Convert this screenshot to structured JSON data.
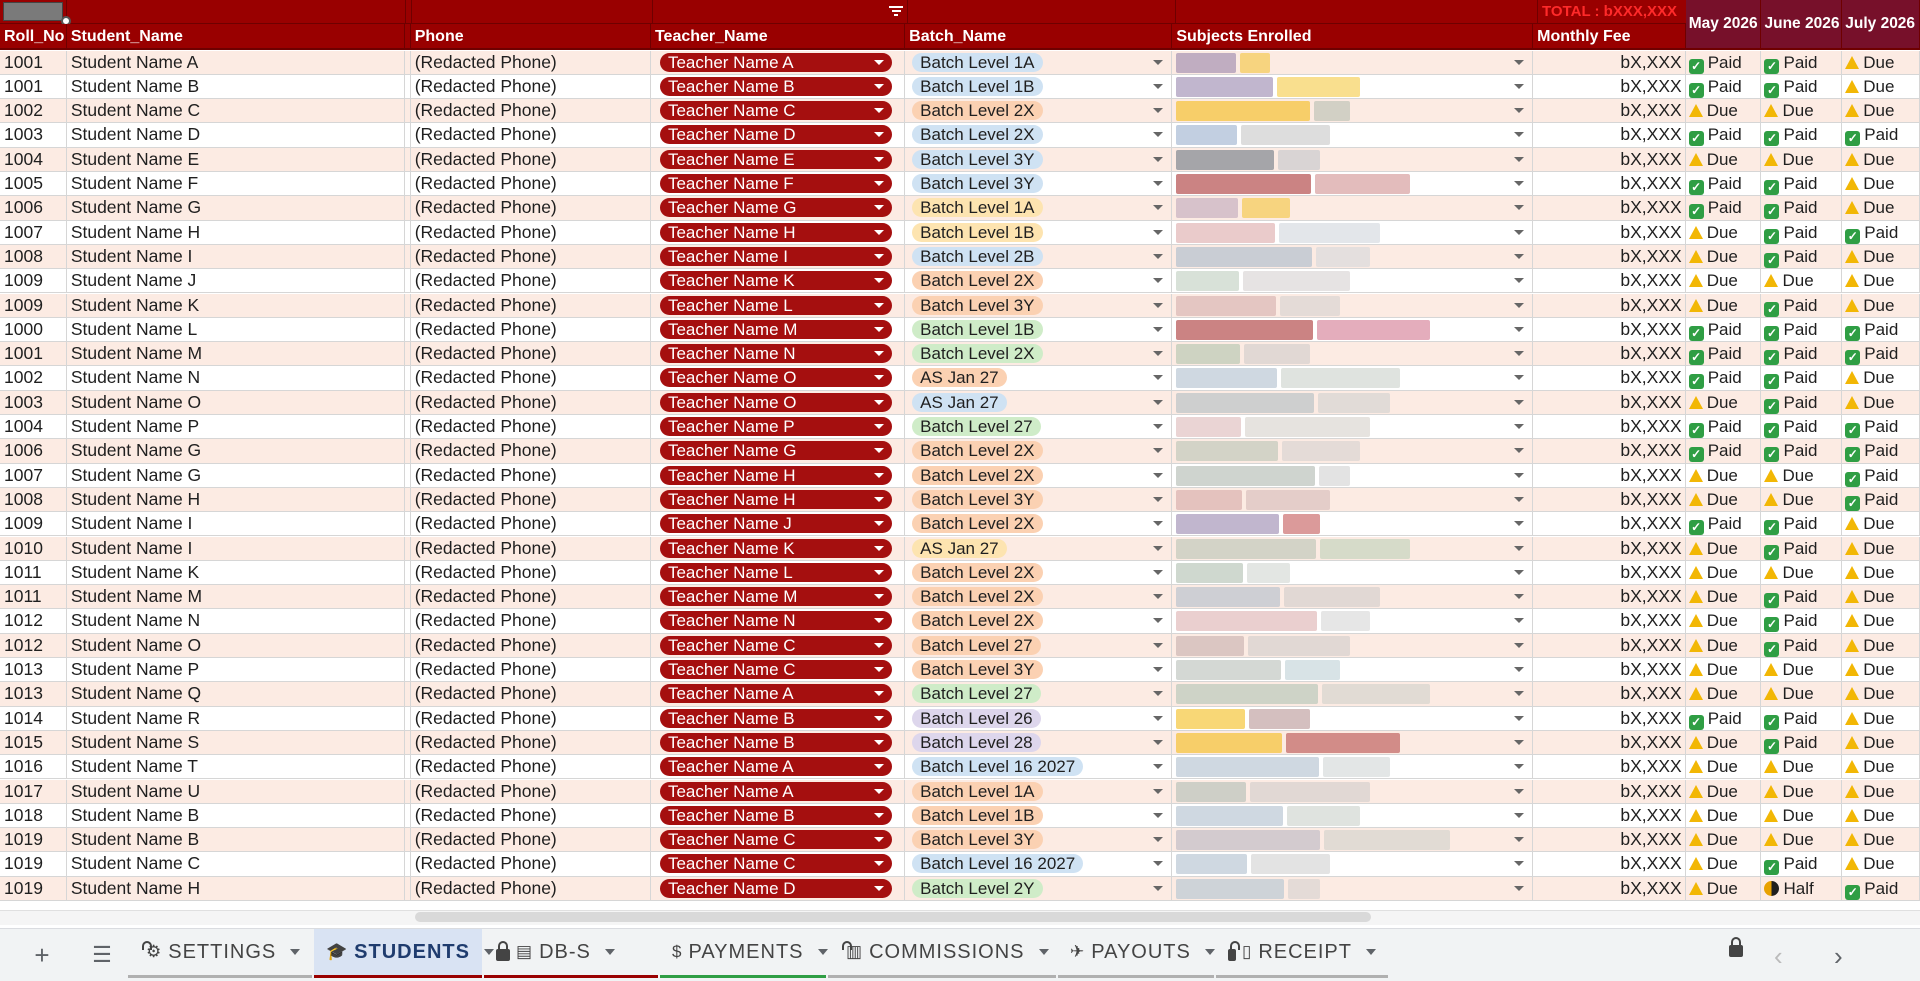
{
  "header": {
    "total_label": "TOTAL : bXXX,XXX",
    "columns": {
      "roll": "Roll_No",
      "name": "Student_Name",
      "phone": "Phone",
      "teacher": "Teacher_Name",
      "batch": "Batch_Name",
      "subjects": "Subjects Enrolled",
      "fee": "Monthly Fee",
      "m1": "May 2026",
      "m2": "June 2026",
      "m3": "July 2026"
    }
  },
  "colors": {
    "header_bg": "#990000",
    "month_header_bg": "#77102a",
    "teacher_chip": "#a50f0f",
    "band": "#fcebe3",
    "paid": "#2f9e44",
    "due": "#f2b705"
  },
  "rows": [
    {
      "roll": "1001",
      "name": "Student Name A",
      "phone": "(Redacted Phone)",
      "teacher": "Teacher Name A",
      "batch": "Batch Level 1A",
      "batch_color": "blue",
      "fee": "bX,XXX",
      "m1": "Paid",
      "m2": "Paid",
      "m3": "Due"
    },
    {
      "roll": "1001",
      "name": "Student Name B",
      "phone": "(Redacted Phone)",
      "teacher": "Teacher Name B",
      "batch": "Batch Level 1B",
      "batch_color": "blue",
      "fee": "bX,XXX",
      "m1": "Paid",
      "m2": "Paid",
      "m3": "Due"
    },
    {
      "roll": "1002",
      "name": "Student Name C",
      "phone": "(Redacted Phone)",
      "teacher": "Teacher Name C",
      "batch": "Batch Level 2X",
      "batch_color": "orange",
      "fee": "bX,XXX",
      "m1": "Due",
      "m2": "Due",
      "m3": "Due"
    },
    {
      "roll": "1003",
      "name": "Student Name D",
      "phone": "(Redacted Phone)",
      "teacher": "Teacher Name D",
      "batch": "Batch Level 2X",
      "batch_color": "blue",
      "fee": "bX,XXX",
      "m1": "Paid",
      "m2": "Paid",
      "m3": "Paid"
    },
    {
      "roll": "1004",
      "name": "Student Name E",
      "phone": "(Redacted Phone)",
      "teacher": "Teacher Name E",
      "batch": "Batch Level 3Y",
      "batch_color": "blue",
      "fee": "bX,XXX",
      "m1": "Due",
      "m2": "Due",
      "m3": "Due"
    },
    {
      "roll": "1005",
      "name": "Student Name F",
      "phone": "(Redacted Phone)",
      "teacher": "Teacher Name F",
      "batch": "Batch Level 3Y",
      "batch_color": "blue",
      "fee": "bX,XXX",
      "m1": "Paid",
      "m2": "Paid",
      "m3": "Due"
    },
    {
      "roll": "1006",
      "name": "Student Name G",
      "phone": "(Redacted Phone)",
      "teacher": "Teacher Name G",
      "batch": "Batch Level 1A",
      "batch_color": "yellow",
      "fee": "bX,XXX",
      "m1": "Paid",
      "m2": "Paid",
      "m3": "Due"
    },
    {
      "roll": "1007",
      "name": "Student Name H",
      "phone": "(Redacted Phone)",
      "teacher": "Teacher Name H",
      "batch": "Batch Level 1B",
      "batch_color": "yellow",
      "fee": "bX,XXX",
      "m1": "Due",
      "m2": "Paid",
      "m3": "Paid"
    },
    {
      "roll": "1008",
      "name": "Student Name I",
      "phone": "(Redacted Phone)",
      "teacher": "Teacher Name I",
      "batch": "Batch Level 2B",
      "batch_color": "blue",
      "fee": "bX,XXX",
      "m1": "Due",
      "m2": "Paid",
      "m3": "Due"
    },
    {
      "roll": "1009",
      "name": "Student Name J",
      "phone": "(Redacted Phone)",
      "teacher": "Teacher Name K",
      "batch": "Batch Level 2X",
      "batch_color": "orange",
      "fee": "bX,XXX",
      "m1": "Due",
      "m2": "Due",
      "m3": "Due"
    },
    {
      "roll": "1009",
      "name": "Student Name K",
      "phone": "(Redacted Phone)",
      "teacher": "Teacher Name L",
      "batch": "Batch Level 3Y",
      "batch_color": "orange",
      "fee": "bX,XXX",
      "m1": "Due",
      "m2": "Paid",
      "m3": "Due"
    },
    {
      "roll": "1000",
      "name": "Student Name L",
      "phone": "(Redacted Phone)",
      "teacher": "Teacher Name M",
      "batch": "Batch Level 1B",
      "batch_color": "green",
      "fee": "bX,XXX",
      "m1": "Paid",
      "m2": "Paid",
      "m3": "Paid"
    },
    {
      "roll": "1001",
      "name": "Student Name M",
      "phone": "(Redacted Phone)",
      "teacher": "Teacher Name N",
      "batch": "Batch Level 2X",
      "batch_color": "green",
      "fee": "bX,XXX",
      "m1": "Paid",
      "m2": "Paid",
      "m3": "Paid"
    },
    {
      "roll": "1002",
      "name": "Student Name N",
      "phone": "(Redacted Phone)",
      "teacher": "Teacher Name O",
      "batch": "AS Jan 27",
      "batch_color": "orange",
      "fee": "bX,XXX",
      "m1": "Paid",
      "m2": "Paid",
      "m3": "Due"
    },
    {
      "roll": "1003",
      "name": "Student Name O",
      "phone": "(Redacted Phone)",
      "teacher": "Teacher Name O",
      "batch": "AS Jan 27",
      "batch_color": "blue",
      "fee": "bX,XXX",
      "m1": "Due",
      "m2": "Paid",
      "m3": "Due"
    },
    {
      "roll": "1004",
      "name": "Student Name P",
      "phone": "(Redacted Phone)",
      "teacher": "Teacher Name P",
      "batch": "Batch Level 27",
      "batch_color": "green",
      "fee": "bX,XXX",
      "m1": "Paid",
      "m2": "Paid",
      "m3": "Paid"
    },
    {
      "roll": "1006",
      "name": "Student Name G",
      "phone": "(Redacted Phone)",
      "teacher": "Teacher Name G",
      "batch": "Batch Level 2X",
      "batch_color": "orange",
      "fee": "bX,XXX",
      "m1": "Paid",
      "m2": "Paid",
      "m3": "Paid"
    },
    {
      "roll": "1007",
      "name": "Student Name G",
      "phone": "(Redacted Phone)",
      "teacher": "Teacher Name H",
      "batch": "Batch Level 2X",
      "batch_color": "orange",
      "fee": "bX,XXX",
      "m1": "Due",
      "m2": "Due",
      "m3": "Paid"
    },
    {
      "roll": "1008",
      "name": "Student Name H",
      "phone": "(Redacted Phone)",
      "teacher": "Teacher Name H",
      "batch": "Batch Level 3Y",
      "batch_color": "orange",
      "fee": "bX,XXX",
      "m1": "Due",
      "m2": "Due",
      "m3": "Paid"
    },
    {
      "roll": "1009",
      "name": "Student Name I",
      "phone": "(Redacted Phone)",
      "teacher": "Teacher Name J",
      "batch": "Batch Level 2X",
      "batch_color": "orange",
      "fee": "bX,XXX",
      "m1": "Paid",
      "m2": "Paid",
      "m3": "Due"
    },
    {
      "roll": "1010",
      "name": "Student Name I",
      "phone": "(Redacted Phone)",
      "teacher": "Teacher Name K",
      "batch": "AS Jan 27",
      "batch_color": "yellow",
      "fee": "bX,XXX",
      "m1": "Due",
      "m2": "Paid",
      "m3": "Due"
    },
    {
      "roll": "1011",
      "name": "Student Name K",
      "phone": "(Redacted Phone)",
      "teacher": "Teacher Name L",
      "batch": "Batch Level 2X",
      "batch_color": "orange",
      "fee": "bX,XXX",
      "m1": "Due",
      "m2": "Due",
      "m3": "Due"
    },
    {
      "roll": "1011",
      "name": "Student Name M",
      "phone": "(Redacted Phone)",
      "teacher": "Teacher Name M",
      "batch": "Batch Level 2X",
      "batch_color": "orange",
      "fee": "bX,XXX",
      "m1": "Due",
      "m2": "Paid",
      "m3": "Due"
    },
    {
      "roll": "1012",
      "name": "Student Name N",
      "phone": "(Redacted Phone)",
      "teacher": "Teacher Name N",
      "batch": "Batch Level 2X",
      "batch_color": "orange",
      "fee": "bX,XXX",
      "m1": "Due",
      "m2": "Paid",
      "m3": "Due"
    },
    {
      "roll": "1012",
      "name": "Student Name O",
      "phone": "(Redacted Phone)",
      "teacher": "Teacher Name C",
      "batch": "Batch Level 27",
      "batch_color": "orange",
      "fee": "bX,XXX",
      "m1": "Due",
      "m2": "Paid",
      "m3": "Due"
    },
    {
      "roll": "1013",
      "name": "Student Name P",
      "phone": "(Redacted Phone)",
      "teacher": "Teacher Name C",
      "batch": "Batch Level 3Y",
      "batch_color": "orange",
      "fee": "bX,XXX",
      "m1": "Due",
      "m2": "Due",
      "m3": "Due"
    },
    {
      "roll": "1013",
      "name": "Student Name Q",
      "phone": "(Redacted Phone)",
      "teacher": "Teacher Name A",
      "batch": "Batch Level 27",
      "batch_color": "green",
      "fee": "bX,XXX",
      "m1": "Due",
      "m2": "Due",
      "m3": "Due"
    },
    {
      "roll": "1014",
      "name": "Student Name R",
      "phone": "(Redacted Phone)",
      "teacher": "Teacher Name B",
      "batch": "Batch Level 26",
      "batch_color": "purple",
      "fee": "bX,XXX",
      "m1": "Paid",
      "m2": "Paid",
      "m3": "Due"
    },
    {
      "roll": "1015",
      "name": "Student Name S",
      "phone": "(Redacted Phone)",
      "teacher": "Teacher Name B",
      "batch": "Batch Level 28",
      "batch_color": "purple",
      "fee": "bX,XXX",
      "m1": "Due",
      "m2": "Paid",
      "m3": "Due"
    },
    {
      "roll": "1016",
      "name": "Student Name T",
      "phone": "(Redacted Phone)",
      "teacher": "Teacher Name A",
      "batch": "Batch Level 16 2027",
      "batch_color": "blue",
      "fee": "bX,XXX",
      "m1": "Due",
      "m2": "Due",
      "m3": "Due"
    },
    {
      "roll": "1017",
      "name": "Student Name U",
      "phone": "(Redacted Phone)",
      "teacher": "Teacher Name A",
      "batch": "Batch Level 1A",
      "batch_color": "orange",
      "fee": "bX,XXX",
      "m1": "Due",
      "m2": "Due",
      "m3": "Due"
    },
    {
      "roll": "1018",
      "name": "Student Name B",
      "phone": "(Redacted Phone)",
      "teacher": "Teacher Name B",
      "batch": "Batch Level 1B",
      "batch_color": "orange",
      "fee": "bX,XXX",
      "m1": "Due",
      "m2": "Due",
      "m3": "Due"
    },
    {
      "roll": "1019",
      "name": "Student Name B",
      "phone": "(Redacted Phone)",
      "teacher": "Teacher Name C",
      "batch": "Batch Level 3Y",
      "batch_color": "orange",
      "fee": "bX,XXX",
      "m1": "Due",
      "m2": "Due",
      "m3": "Due"
    },
    {
      "roll": "1019",
      "name": "Student Name C",
      "phone": "(Redacted Phone)",
      "teacher": "Teacher Name C",
      "batch": "Batch Level 16 2027",
      "batch_color": "blue",
      "fee": "bX,XXX",
      "m1": "Due",
      "m2": "Paid",
      "m3": "Due"
    },
    {
      "roll": "1019",
      "name": "Student Name H",
      "phone": "(Redacted Phone)",
      "teacher": "Teacher Name D",
      "batch": "Batch Level 2Y",
      "batch_color": "green",
      "fee": "bX,XXX",
      "m1": "Due",
      "m2": "Half",
      "m3": "Paid"
    }
  ],
  "tabbar": {
    "tabs": [
      {
        "label": "SETTINGS",
        "icon": "gear-icon",
        "locked": true,
        "active": false
      },
      {
        "label": "STUDENTS",
        "icon": "graduation-cap-icon",
        "locked": false,
        "active": true
      },
      {
        "label": "DB-S",
        "icon": "database-icon",
        "locked": true,
        "active": false
      },
      {
        "label": "PAYMENTS",
        "icon": "money-bag-icon",
        "locked": false,
        "active": false
      },
      {
        "label": "COMMISSIONS",
        "icon": "bar-chart-icon",
        "locked": true,
        "active": false
      },
      {
        "label": "PAYOUTS",
        "icon": "money-wings-icon",
        "locked": false,
        "active": false
      },
      {
        "label": "RECEIPT",
        "icon": "receipt-icon",
        "locked": true,
        "active": false
      }
    ]
  }
}
